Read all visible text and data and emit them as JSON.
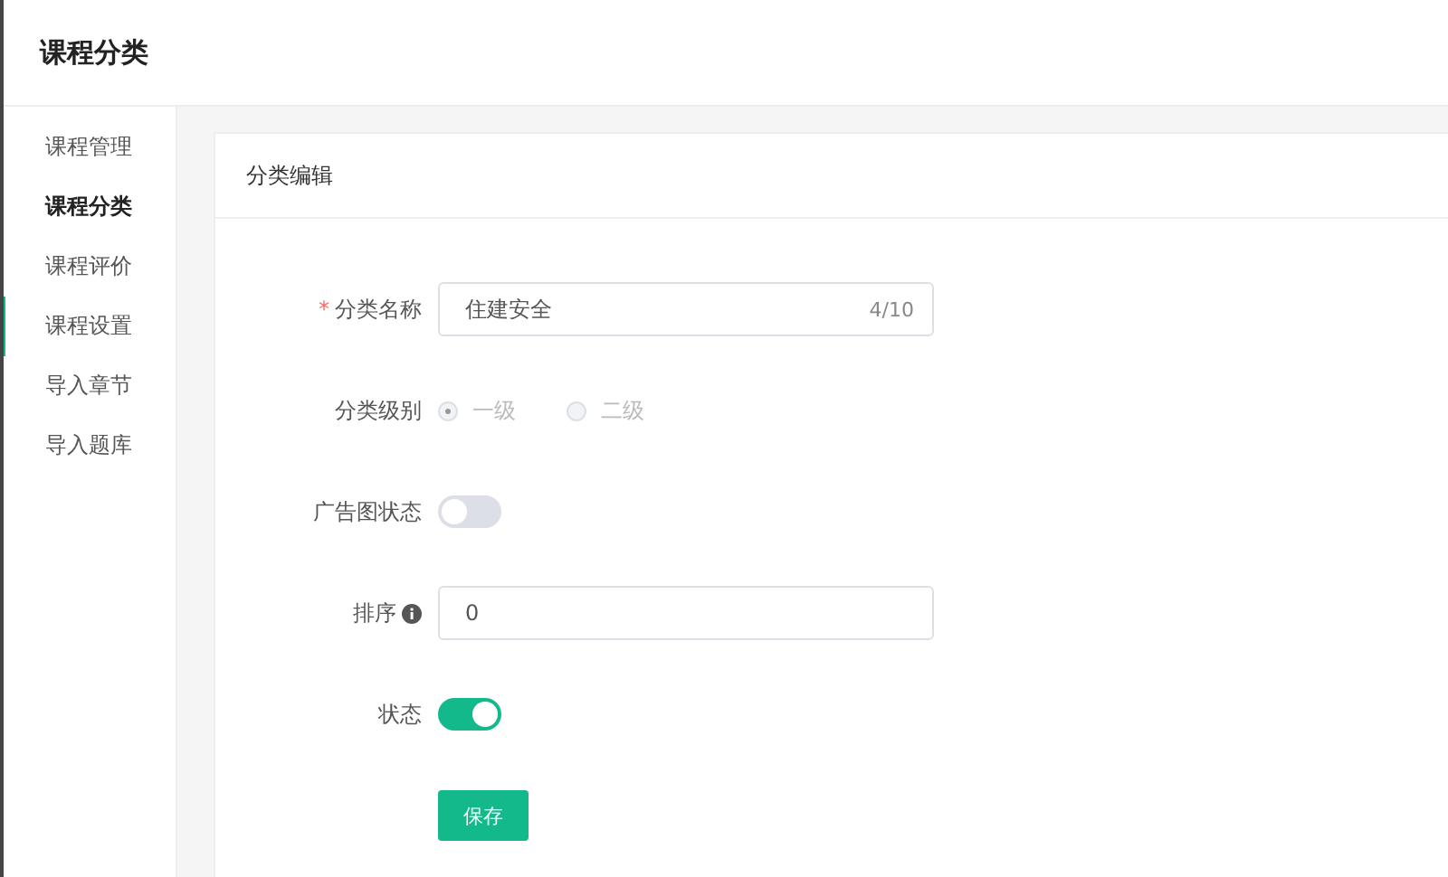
{
  "header": {
    "title": "课程分类"
  },
  "sidebar": {
    "items": [
      {
        "label": "课程管理",
        "selected": false,
        "hovered": false
      },
      {
        "label": "课程分类",
        "selected": true,
        "hovered": false
      },
      {
        "label": "课程评价",
        "selected": false,
        "hovered": false
      },
      {
        "label": "课程设置",
        "selected": false,
        "hovered": true
      },
      {
        "label": "导入章节",
        "selected": false,
        "hovered": false
      },
      {
        "label": "导入题库",
        "selected": false,
        "hovered": false
      }
    ]
  },
  "card": {
    "title": "分类编辑",
    "fields": [
      {
        "kind": "text",
        "label": "分类名称",
        "required_mark": "*",
        "value": "住建安全",
        "counter": "4/10"
      },
      {
        "kind": "radio",
        "label": "分类级别",
        "disabled": true,
        "options": [
          {
            "label": "一级",
            "selected": true
          },
          {
            "label": "二级",
            "selected": false
          }
        ]
      },
      {
        "kind": "switch",
        "label": "广告图状态",
        "on": false
      },
      {
        "kind": "text",
        "label": "排序",
        "info": true,
        "value": "0"
      },
      {
        "kind": "switch",
        "label": "状态",
        "on": true
      }
    ],
    "save_button": "保存"
  }
}
